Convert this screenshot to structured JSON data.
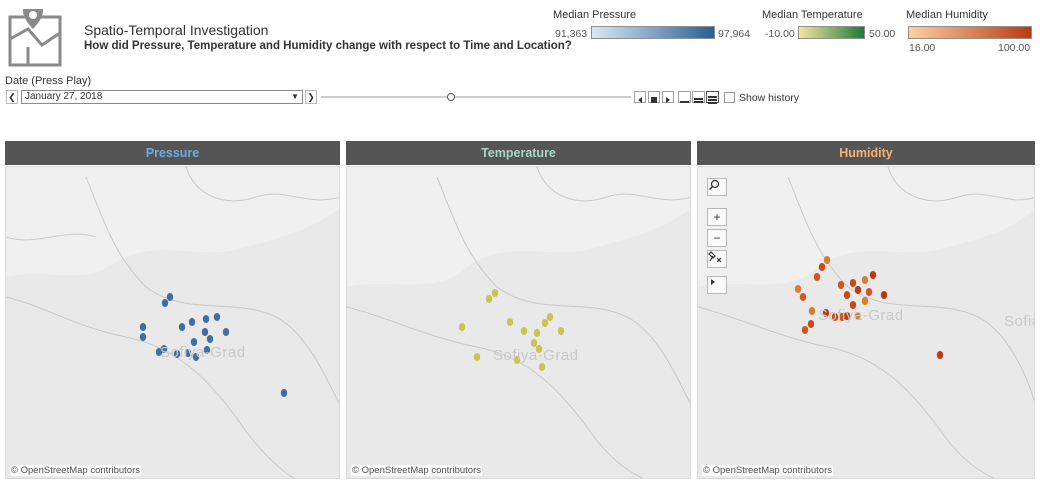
{
  "header": {
    "title": "Spatio-Temporal Investigation",
    "subtitle": "How did Pressure, Temperature and Humidity change with respect to Time and Location?"
  },
  "legends": {
    "pressure": {
      "title": "Median Pressure",
      "min": "91,363",
      "max": "97,964",
      "color_from": "#d6eaf5",
      "color_to": "#2b5e94"
    },
    "temperature": {
      "title": "Median Temperature",
      "min": "-10.00",
      "max": "50.00",
      "color_from": "#f4e69a",
      "color_to": "#1d7a3a"
    },
    "humidity": {
      "title": "Median Humidity",
      "min": "16.00",
      "max": "100.00",
      "color_from": "#fdd0a2",
      "color_to": "#b93a12"
    }
  },
  "controls": {
    "date_label": "Date (Press Play)",
    "date_value": "January 27, 2018",
    "show_history": "Show history",
    "slider_position": 0.42
  },
  "panels": {
    "pressure": {
      "title": "Pressure",
      "title_color": "#6aaee0",
      "attribution": "© OpenStreetMap contributors",
      "city": "Sofiya-Grad",
      "dot_color": "#3f6ea3"
    },
    "temperature": {
      "title": "Temperature",
      "title_color": "#a9d6c8",
      "attribution": "© OpenStreetMap contributors",
      "city": "Sofiya-Grad",
      "dot_color": "#c6c650"
    },
    "humidity": {
      "title": "Humidity",
      "title_color": "#f3b373",
      "attribution": "© OpenStreetMap contributors",
      "city": "Sofiya-Grad",
      "city2": "Sofia",
      "dot_color": "#d1561f"
    }
  },
  "map_tools": {
    "search": "search-icon",
    "zoom_in": "+",
    "zoom_out": "−",
    "pin": "pin-icon",
    "expand": "arrow-right-icon"
  }
}
